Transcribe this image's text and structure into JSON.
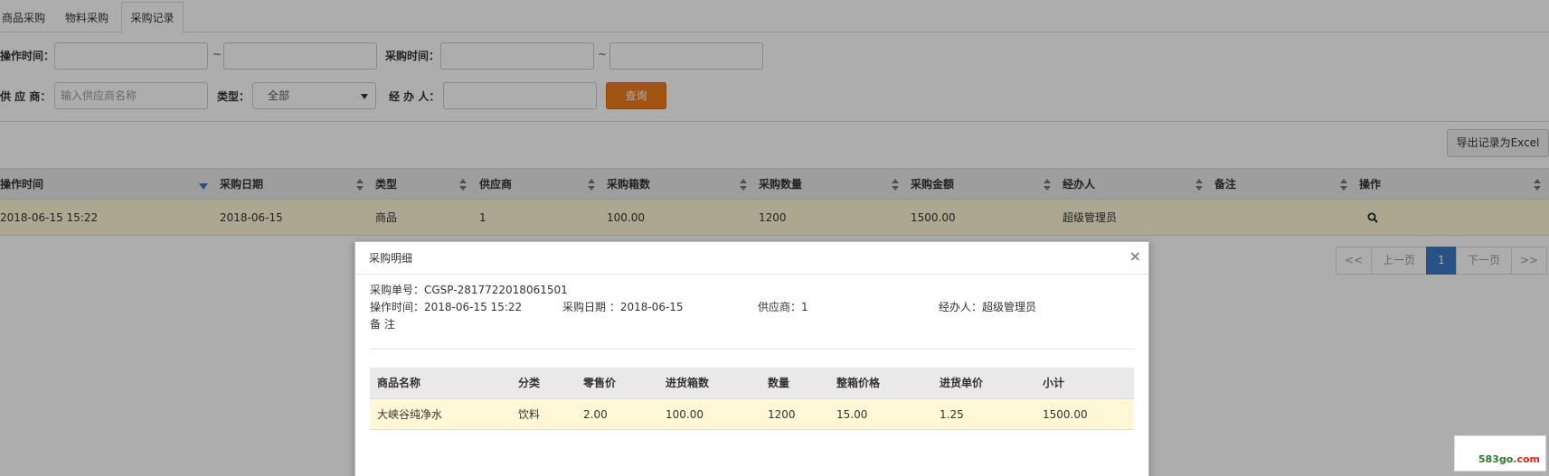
{
  "tabs": [
    {
      "label": "商品采购"
    },
    {
      "label": "物料采购"
    },
    {
      "label": "采购记录"
    }
  ],
  "filters": {
    "operate_time_label": "操作时间：",
    "purchase_time_label": "采购时间：",
    "range_sep": "~",
    "supplier_label": "供 应 商：",
    "supplier_placeholder": "输入供应商名称",
    "type_label": "类型：",
    "type_selected": "全部",
    "handler_label": "经 办 人：",
    "query_button": "查询"
  },
  "export_button": "导出记录为Excel",
  "table": {
    "columns": [
      "操作时间",
      "采购日期",
      "类型",
      "供应商",
      "采购箱数",
      "采购数量",
      "采购金额",
      "经办人",
      "备注",
      "操作"
    ],
    "rows": [
      {
        "operate_time": "2018-06-15 15:22",
        "purchase_date": "2018-06-15",
        "type": "商品",
        "supplier": "1",
        "boxes": "100.00",
        "quantity": "1200",
        "amount": "1500.00",
        "handler": "超级管理员",
        "remark": ""
      }
    ]
  },
  "pager": {
    "first": "<<",
    "prev": "上一页",
    "current": "1",
    "next": "下一页",
    "last": ">>"
  },
  "modal": {
    "title": "采购明细",
    "close": "×",
    "order_no": "采购单号：CGSP-2817722018061501",
    "operate_time": "操作时间：2018-06-15 15:22",
    "purchase_date": "采购日期 ：2018-06-15",
    "supplier": "供应商：1",
    "handler": "经办人：超级管理员",
    "remark": "备 注",
    "detail_columns": [
      "商品名称",
      "分类",
      "零售价",
      "进货箱数",
      "数量",
      "整箱价格",
      "进货单价",
      "小计"
    ],
    "detail_rows": [
      {
        "name": "大峡谷纯净水",
        "category": "饮料",
        "retail_price": "2.00",
        "boxes": "100.00",
        "quantity": "1200",
        "box_price": "15.00",
        "unit_price": "1.25",
        "subtotal": "1500.00"
      }
    ]
  },
  "watermark": {
    "prefix": "583go.",
    "suffix": "com"
  },
  "colors": {
    "accent_orange": "#ed7d1c",
    "pager_active": "#3c78c4",
    "row_highlight": "#fff7d6",
    "watermark_green": "#2a7d2a",
    "watermark_red": "#e0241b"
  }
}
